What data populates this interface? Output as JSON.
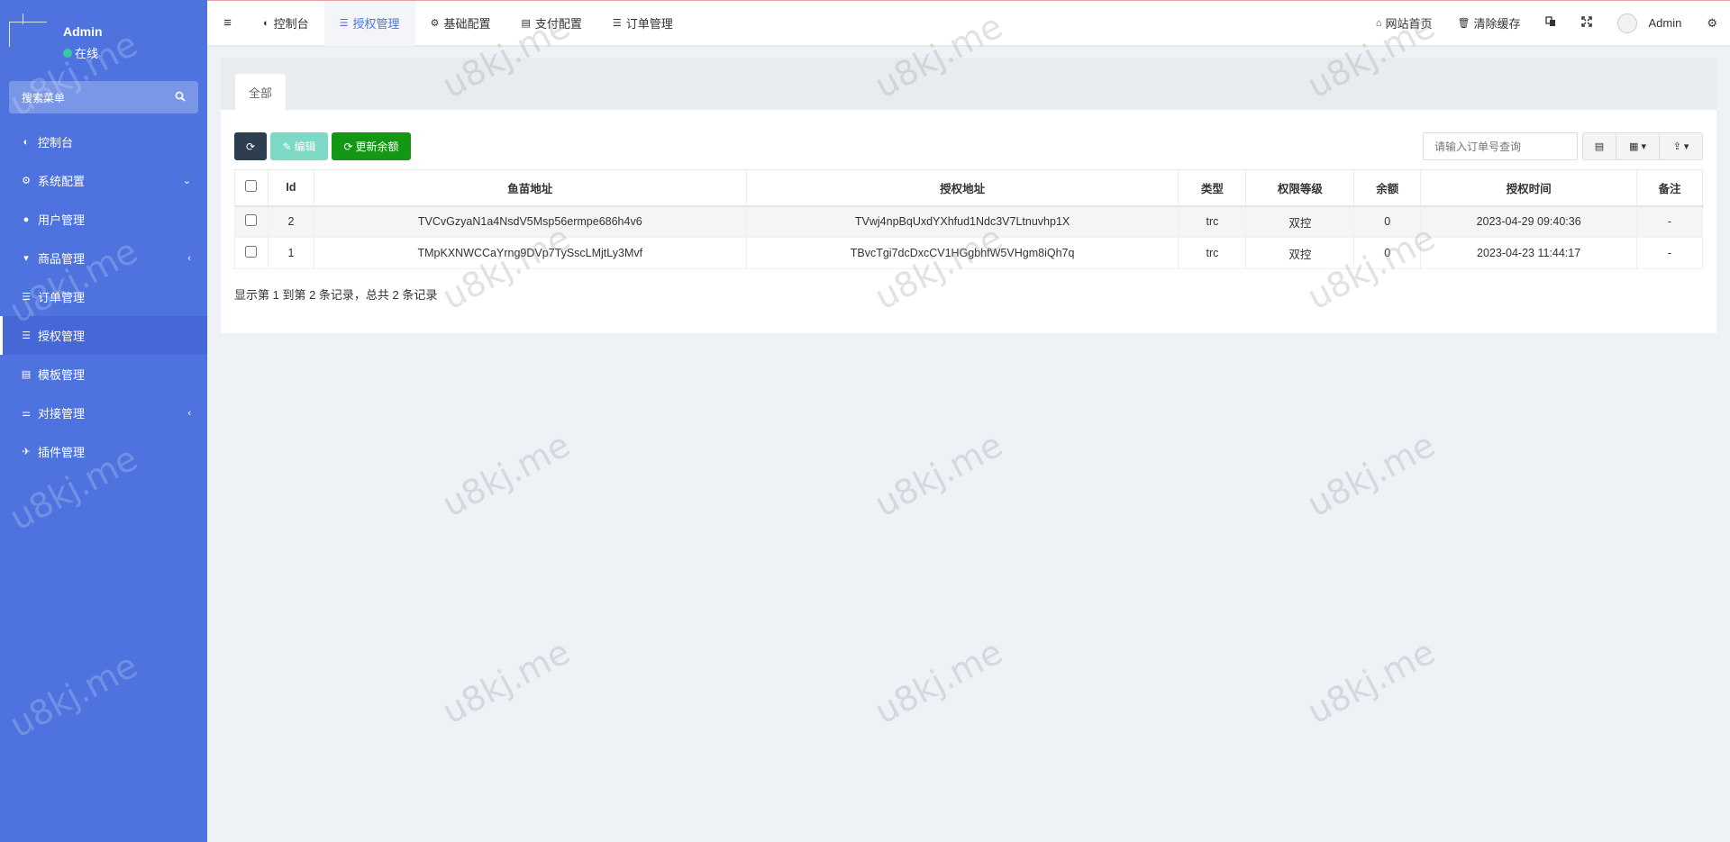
{
  "sidebar": {
    "user_name": "Admin",
    "user_status": "在线",
    "search_label": "搜索菜单",
    "items": [
      {
        "label": "控制台",
        "icon": "dashboard-icon",
        "glyph": "◐"
      },
      {
        "label": "系统配置",
        "icon": "gear-icon",
        "glyph": "⚙",
        "arrow": "⌄"
      },
      {
        "label": "用户管理",
        "icon": "user-icon",
        "glyph": "●"
      },
      {
        "label": "商品管理",
        "icon": "cart-icon",
        "glyph": "▾",
        "arrow": "‹"
      },
      {
        "label": "订单管理",
        "icon": "list-icon",
        "glyph": "☰"
      },
      {
        "label": "授权管理",
        "icon": "list-icon",
        "glyph": "☰",
        "active": true
      },
      {
        "label": "模板管理",
        "icon": "table-icon",
        "glyph": "▤"
      },
      {
        "label": "对接管理",
        "icon": "sliders-icon",
        "glyph": "⚌",
        "arrow": "‹"
      },
      {
        "label": "插件管理",
        "icon": "rocket-icon",
        "glyph": "✈"
      }
    ]
  },
  "topnav": {
    "tabs": [
      {
        "label": "控制台",
        "glyph": "◐"
      },
      {
        "label": "授权管理",
        "glyph": "☰",
        "active": true
      },
      {
        "label": "基础配置",
        "glyph": "⚙"
      },
      {
        "label": "支付配置",
        "glyph": "▤"
      },
      {
        "label": "订单管理",
        "glyph": "☰"
      }
    ],
    "home_label": "网站首页",
    "clear_cache_label": "清除缓存",
    "admin_label": "Admin"
  },
  "content": {
    "tab_all": "全部",
    "edit_label": "编辑",
    "update_balance_label": "更新余额",
    "search_placeholder": "请输入订单号查询",
    "columns": [
      "Id",
      "鱼苗地址",
      "授权地址",
      "类型",
      "权限等级",
      "余额",
      "授权时间",
      "备注"
    ],
    "rows": [
      {
        "id": "2",
        "fish_address": "TVCvGzyaN1a4NsdV5Msp56ermpe686h4v6",
        "auth_address": "TVwj4npBqUxdYXhfud1Ndc3V7Ltnuvhp1X",
        "type": "trc",
        "level": "双控",
        "balance": "0",
        "time": "2023-04-29 09:40:36",
        "note": "-"
      },
      {
        "id": "1",
        "fish_address": "TMpKXNWCCaYrng9DVp7TySscLMjtLy3Mvf",
        "auth_address": "TBvcTgi7dcDxcCV1HGgbhfW5VHgm8iQh7q",
        "type": "trc",
        "level": "双控",
        "balance": "0",
        "time": "2023-04-23 11:44:17",
        "note": "-"
      }
    ],
    "pagination_info": "显示第 1 到第 2 条记录，总共 2 条记录"
  },
  "watermark_text": "u8kj.me"
}
